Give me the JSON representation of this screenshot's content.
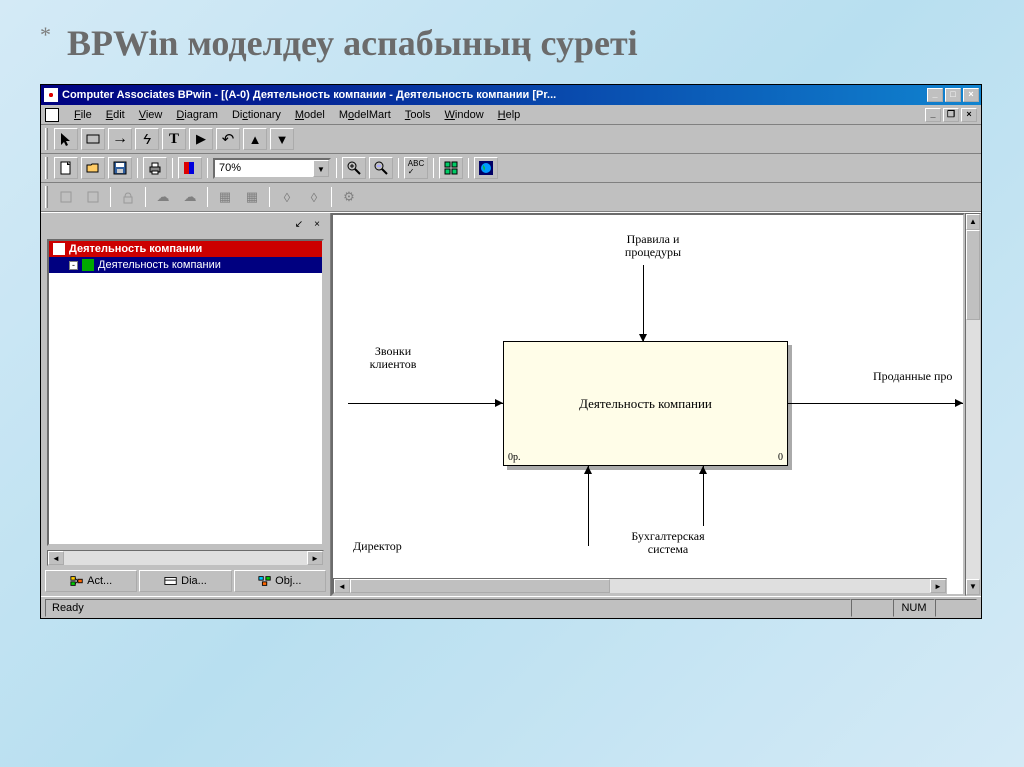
{
  "slide": {
    "asterisk": "*",
    "title": "BPWin  моделдеу аспабының суреті"
  },
  "window": {
    "title": "Computer Associates BPwin - [(A-0) Деятельность компании - Деятельность компании  [Pr...",
    "sysbuttons": {
      "min": "_",
      "max": "□",
      "close": "×"
    }
  },
  "menu": {
    "items": [
      "File",
      "Edit",
      "View",
      "Diagram",
      "Dictionary",
      "Model",
      "ModelMart",
      "Tools",
      "Window",
      "Help"
    ]
  },
  "toolbar2": {
    "zoom": "70%"
  },
  "tree": {
    "root": "Деятельность компании",
    "child": "Деятельность компании"
  },
  "side_tabs": {
    "act": "Act...",
    "dia": "Dia...",
    "obj": "Obj..."
  },
  "diagram": {
    "control": "Правила и\nпроцедуры",
    "input": "Звонки\nклиентов",
    "activity": "Деятельность компании",
    "corner_left": "0p.",
    "corner_right": "0",
    "output": "Проданные про",
    "mech1": "Директор",
    "mech2": "Бухгалтерская\nсистема"
  },
  "status": {
    "ready": "Ready",
    "num": "NUM"
  }
}
